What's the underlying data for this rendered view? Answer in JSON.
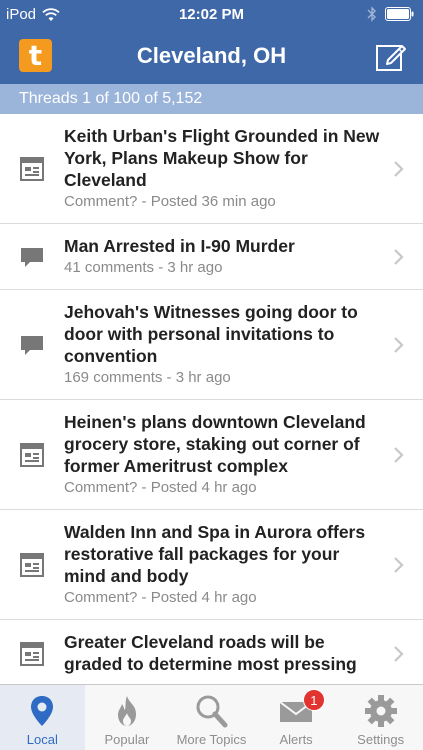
{
  "status": {
    "carrier": "iPod",
    "time": "12:02 PM"
  },
  "nav": {
    "logo_letter": "t",
    "title": "Cleveland, OH"
  },
  "thread_bar": "Threads 1 of 100 of 5,152",
  "threads": [
    {
      "type": "article",
      "title": "Keith Urban's Flight Grounded in New York, Plans Makeup Show for Cleveland",
      "meta": "Comment? - Posted 36 min ago"
    },
    {
      "type": "discussion",
      "title": "Man Arrested in I-90 Murder",
      "meta": "41 comments - 3 hr ago"
    },
    {
      "type": "discussion",
      "title": "Jehovah's Witnesses going door to door with personal invitations to convention",
      "meta": "169 comments - 3 hr ago"
    },
    {
      "type": "article",
      "title": "Heinen's plans downtown Cleveland grocery store, staking out corner of former Ameritrust complex",
      "meta": "Comment? - Posted 4 hr ago"
    },
    {
      "type": "article",
      "title": "Walden Inn and Spa in Aurora offers restorative fall packages for your mind and body",
      "meta": "Comment? - Posted 4 hr ago"
    },
    {
      "type": "article",
      "title": "Greater Cleveland roads will be graded to determine most pressing",
      "meta": ""
    }
  ],
  "tabs": [
    {
      "label": "Local",
      "icon": "map-pin-icon",
      "active": true
    },
    {
      "label": "Popular",
      "icon": "flame-icon",
      "active": false
    },
    {
      "label": "More Topics",
      "icon": "search-icon",
      "active": false
    },
    {
      "label": "Alerts",
      "icon": "mail-icon",
      "active": false,
      "badge": "1"
    },
    {
      "label": "Settings",
      "icon": "gear-icon",
      "active": false
    }
  ],
  "colors": {
    "nav_bg": "#3f68a8",
    "thread_bar_bg": "#9bb4da",
    "logo_orange": "#f39a1f",
    "tab_active": "#2f6bc4",
    "badge_red": "#e1332f"
  }
}
